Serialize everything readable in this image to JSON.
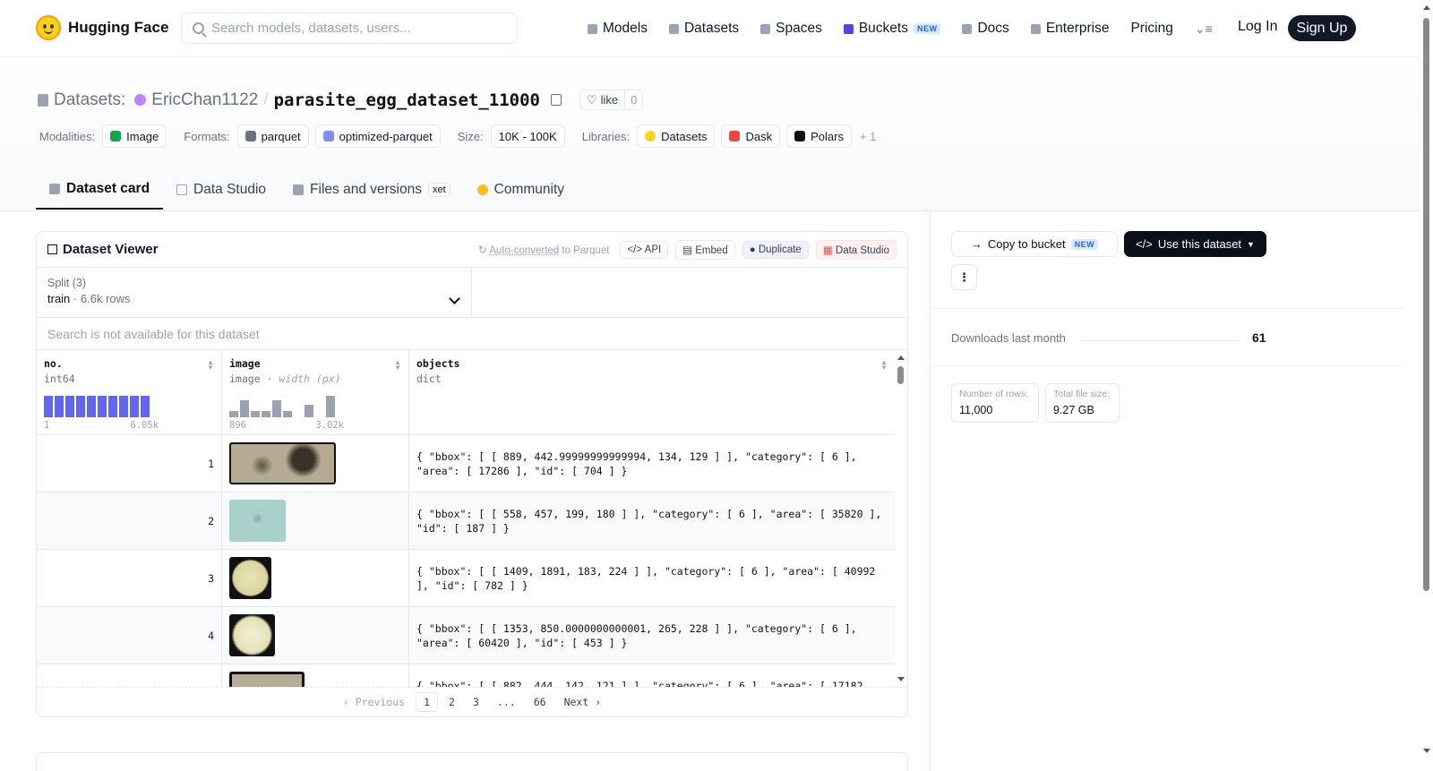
{
  "nav": {
    "brand": "Hugging Face",
    "search_placeholder": "Search models, datasets, users...",
    "links": [
      "Models",
      "Datasets",
      "Spaces",
      "Buckets",
      "Docs",
      "Enterprise",
      "Pricing"
    ],
    "buckets_badge": "NEW",
    "login": "Log In",
    "signup": "Sign Up"
  },
  "header": {
    "section": "Datasets:",
    "owner": "EricChan1122",
    "repo": "parasite_egg_dataset_11000",
    "like_label": "like",
    "like_count": "0",
    "modalities_label": "Modalities:",
    "modality": "Image",
    "formats_label": "Formats:",
    "formats": [
      "parquet",
      "optimized-parquet"
    ],
    "size_label": "Size:",
    "size": "10K - 100K",
    "libraries_label": "Libraries:",
    "libraries": [
      "Datasets",
      "Dask",
      "Polars"
    ],
    "libraries_more": "+ 1"
  },
  "tabs": [
    "Dataset card",
    "Data Studio",
    "Files and versions",
    "Community"
  ],
  "tab_badge": "xet",
  "viewer": {
    "title": "Dataset Viewer",
    "auto_converted": "Auto-converted",
    "to_parquet": " to Parquet",
    "buttons": [
      "API",
      "Embed",
      "Duplicate",
      "Data Studio"
    ],
    "split_label": "Split (3)",
    "split_value": "train",
    "split_rows": "6.6k rows",
    "search_na": "Search is not available for this dataset",
    "columns": [
      {
        "name": "no.",
        "type": "int64",
        "min": "1",
        "max": "6.05k"
      },
      {
        "name": "image",
        "type": "image",
        "type_extra": "width (px)",
        "min": "896",
        "max": "3.02k"
      },
      {
        "name": "objects",
        "type": "dict"
      }
    ],
    "hist_no": [
      1,
      1,
      1,
      1,
      1,
      1,
      1,
      1,
      1,
      1
    ],
    "hist_image": [
      0.3,
      0.8,
      0.3,
      0.3,
      0.8,
      0.3,
      0,
      0.6,
      0,
      1
    ],
    "rows": [
      {
        "no": "1",
        "objects": "{ \"bbox\": [ [ 889, 442.99999999999994, 134, 129 ] ], \"category\": [ 6 ], \"area\": [ 17286 ], \"id\": [ 704 ] }"
      },
      {
        "no": "2",
        "objects": "{ \"bbox\": [ [ 558, 457, 199, 180 ] ], \"category\": [ 6 ], \"area\": [ 35820 ], \"id\": [ 187 ] }"
      },
      {
        "no": "3",
        "objects": "{ \"bbox\": [ [ 1409, 1891, 183, 224 ] ], \"category\": [ 6 ], \"area\": [ 40992 ], \"id\": [ 782 ] }"
      },
      {
        "no": "4",
        "objects": "{ \"bbox\": [ [ 1353, 850.0000000000001, 265, 228 ] ], \"category\": [ 6 ], \"area\": [ 60420 ], \"id\": [ 453 ] }"
      },
      {
        "no": "",
        "objects": "{ \"bbox\": [ [ 882, 444, 142, 121 ] ], \"category\": [ 6 ], \"area\": [ 17182"
      }
    ],
    "pager": {
      "prev": "Previous",
      "pages": [
        "1",
        "2",
        "3",
        "...",
        "66"
      ],
      "next": "Next"
    }
  },
  "sidebar": {
    "copy_bucket": "Copy to bucket",
    "copy_badge": "NEW",
    "use_dataset": "Use this dataset",
    "downloads_label": "Downloads last month",
    "downloads_value": "61",
    "rows_label": "Number of rows:",
    "rows_value": "11,000",
    "size_label": "Total file size:",
    "size_value": "9.27 GB"
  }
}
